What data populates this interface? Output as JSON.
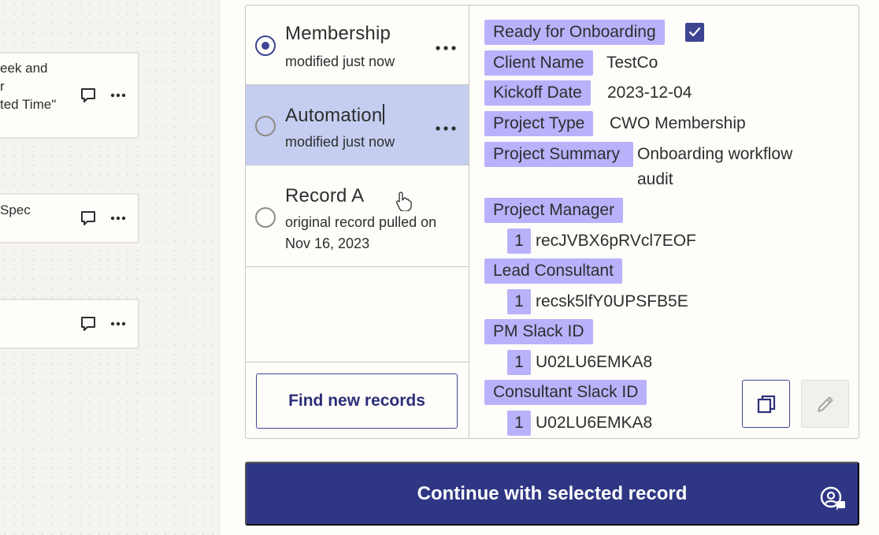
{
  "canvas": {
    "cards": [
      {
        "snippet": "eek and\nr\nted Time\""
      },
      {
        "snippet": "Spec"
      },
      {
        "snippet": ""
      }
    ]
  },
  "records": [
    {
      "title": "Membership",
      "subtitle": "modified just now",
      "selected": true
    },
    {
      "title": "Automation",
      "subtitle": "modified just now",
      "selected": false,
      "editing": true
    },
    {
      "title": "Record A",
      "subtitle": "original record pulled on Nov 16, 2023",
      "selected": false
    }
  ],
  "find_button_label": "Find new records",
  "fields": {
    "ready": {
      "key": "Ready for Onboarding",
      "checked": true
    },
    "client_name": {
      "key": "Client Name",
      "value": "TestCo"
    },
    "kickoff_date": {
      "key": "Kickoff Date",
      "value": "2023-12-04"
    },
    "project_type": {
      "key": "Project Type",
      "value": "CWO Membership"
    },
    "project_summary": {
      "key": "Project Summary",
      "value": "Onboarding workflow audit"
    },
    "project_manager": {
      "key": "Project Manager",
      "count": "1",
      "value": "recJVBX6pRVcl7EOF"
    },
    "lead_consultant": {
      "key": "Lead Consultant",
      "count": "1",
      "value": "recsk5lfY0UPSFB5E"
    },
    "pm_slack_id": {
      "key": "PM Slack ID",
      "count": "1",
      "value": "U02LU6EMKA8"
    },
    "consultant_slack_id": {
      "key": "Consultant Slack ID",
      "count": "1",
      "value": "U02LU6EMKA8"
    }
  },
  "continue_button_label": "Continue with selected record",
  "colors": {
    "primary": "#2f3784",
    "chip": "#b9b2fb",
    "hover_row": "#c5cef0"
  }
}
